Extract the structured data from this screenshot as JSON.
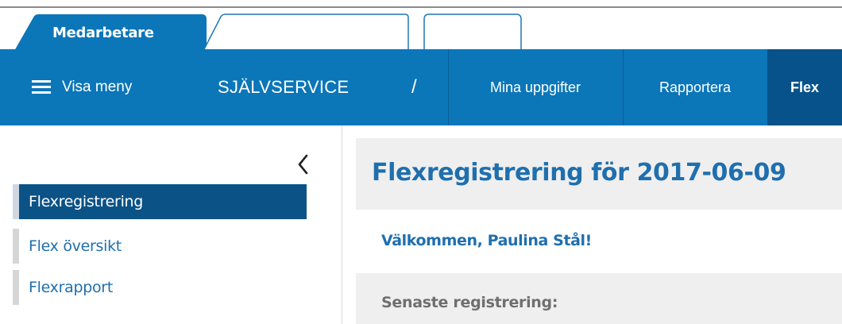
{
  "tabs": [
    {
      "label": "Medarbetare",
      "active": true
    },
    {
      "label": "",
      "active": false
    },
    {
      "label": "",
      "active": false
    }
  ],
  "navbar": {
    "menu_label": "Visa meny",
    "brand": "SJÄLVSERVICE",
    "separator": "/",
    "links": [
      "Mina uppgifter",
      "Rapportera",
      "Flex"
    ],
    "active_link": "Flex",
    "color": "#0b76b8",
    "active_color": "#07528a"
  },
  "sidebar": {
    "collapse_icon": "chevron-left-icon",
    "items": [
      {
        "label": "Flexregistrering",
        "active": true
      },
      {
        "label": "Flex översikt",
        "active": false
      },
      {
        "label": "Flexrapport",
        "active": false
      }
    ]
  },
  "main": {
    "title": "Flexregistrering för 2017-06-09",
    "welcome": "Välkommen, Paulina Stål!",
    "latest_label": "Senaste registrering:"
  }
}
